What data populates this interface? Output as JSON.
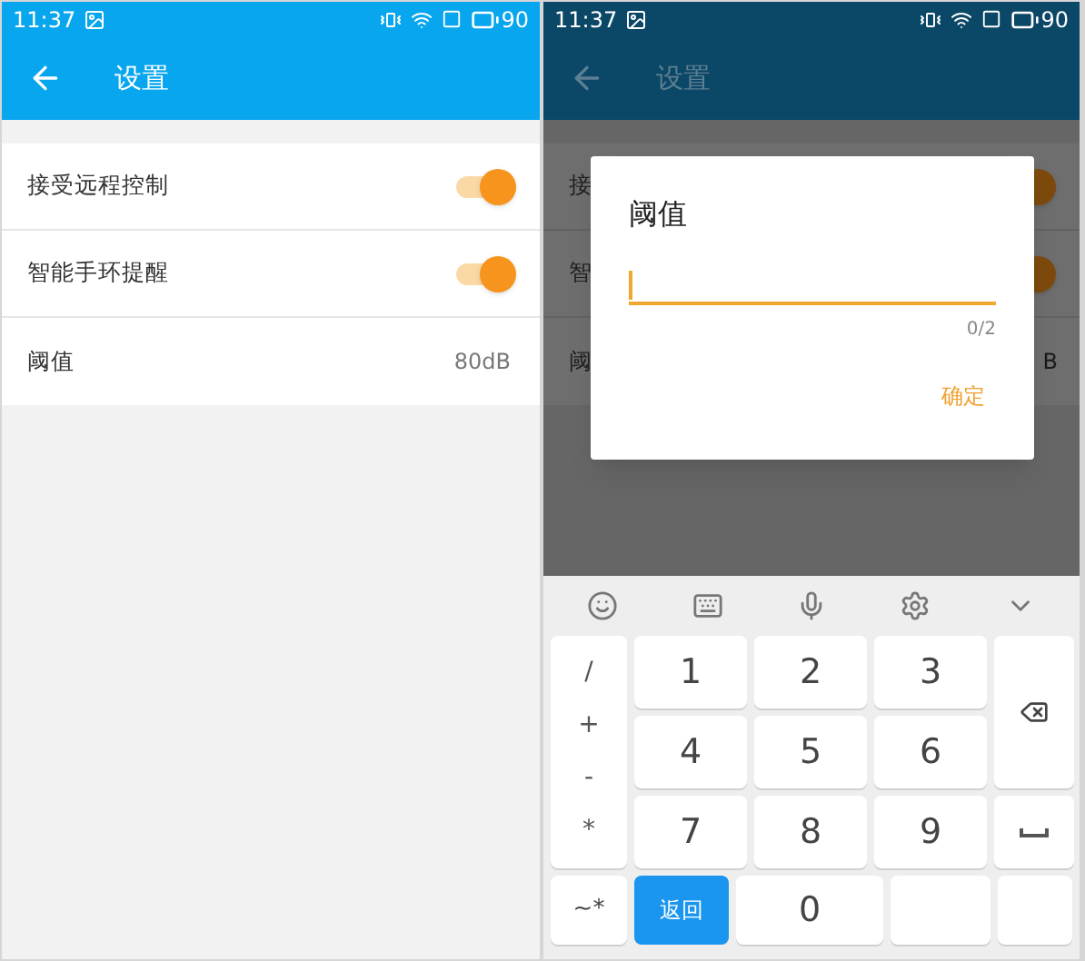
{
  "left": {
    "status_bar": {
      "time": "11:37",
      "battery": "90"
    },
    "app_bar": {
      "title": "设置"
    },
    "settings": [
      {
        "kind": "toggle",
        "label": "接受远程控制",
        "on": true
      },
      {
        "kind": "toggle",
        "label": "智能手环提醒",
        "on": true
      },
      {
        "kind": "value",
        "label": "阈值",
        "value": "80dB"
      }
    ]
  },
  "right": {
    "status_bar": {
      "time": "11:37",
      "battery": "90"
    },
    "app_bar": {
      "title": "设置"
    },
    "settings": [
      {
        "kind": "toggle",
        "label": "接",
        "on": true
      },
      {
        "kind": "toggle",
        "label": "智",
        "on": true
      },
      {
        "kind": "value",
        "label": "阈",
        "value": "B"
      }
    ],
    "dialog": {
      "title": "阈值",
      "input": {
        "counter": "0/2",
        "focused": true
      },
      "buttons": [
        "确定"
      ]
    },
    "keyboard": {
      "side_keys": [
        "/",
        "+",
        "-",
        "*"
      ],
      "digits": [
        "1",
        "2",
        "3",
        "4",
        "5",
        "6",
        "7",
        "8",
        "9"
      ],
      "symbol_key": "~*",
      "back_key": "返回",
      "zero_key": "0"
    }
  }
}
